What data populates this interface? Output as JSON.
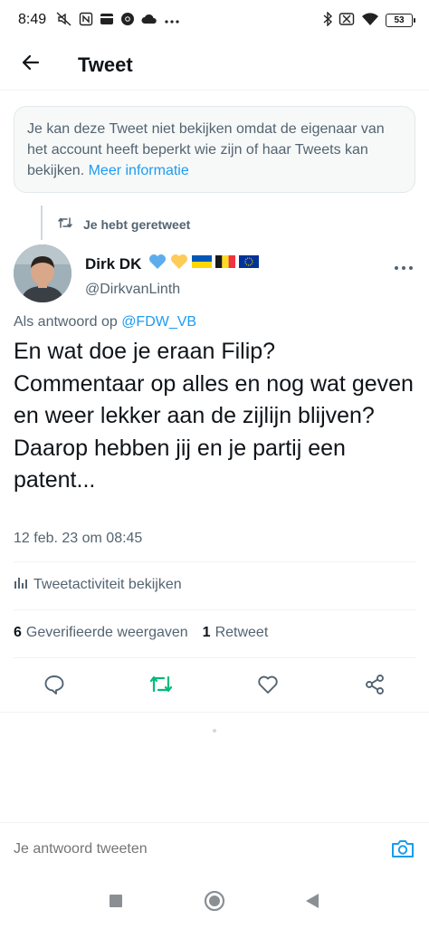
{
  "status_bar": {
    "time": "8:49",
    "left_icons": [
      "muted-icon",
      "nfc-icon",
      "card-icon",
      "chrome-icon",
      "cloud-icon",
      "more-dots-icon"
    ],
    "right_icons": [
      "bluetooth-icon",
      "no-sim-icon",
      "wifi-icon",
      "battery-icon"
    ],
    "battery": "53"
  },
  "header": {
    "title": "Tweet",
    "back_icon": "arrow-left-icon"
  },
  "notice": {
    "text": "Je kan deze Tweet niet bekijken omdat de eigenaar van het account heeft beperkt wie zijn of haar Tweets kan bekijken. ",
    "link": "Meer informatie"
  },
  "retweet_banner": {
    "label": "Je hebt geretweet",
    "icon": "retweet-icon"
  },
  "tweet": {
    "author_name": "Dirk DK",
    "author_emojis": [
      "blue-heart",
      "yellow-heart",
      "ukraine-flag",
      "belgium-flag",
      "eu-flag"
    ],
    "handle": "@DirkvanLinth",
    "reply_prefix": "Als antwoord op ",
    "reply_to": "@FDW_VB",
    "text": "En wat doe je eraan Filip?\nCommentaar op alles en nog wat geven en weer lekker aan de zijlijn blijven?\nDaarop hebben jij en je partij een patent...",
    "date": "12 feb. 23 om 08:45"
  },
  "activity": {
    "label": "Tweetactiviteit bekijken",
    "icon": "bar-chart-icon"
  },
  "stats": {
    "views_count": "6",
    "views_label": "Geverifieerde weergaven",
    "retweets_count": "1",
    "retweets_label": "Retweet"
  },
  "actions": [
    "reply-icon",
    "retweet-icon",
    "like-icon",
    "share-icon"
  ],
  "compose": {
    "placeholder": "Je antwoord tweeten",
    "icon": "camera-icon"
  },
  "colors": {
    "accent": "#1d9bf0",
    "retweet_green": "#00ba7c",
    "text_primary": "#0f1419",
    "text_secondary": "#536471"
  }
}
